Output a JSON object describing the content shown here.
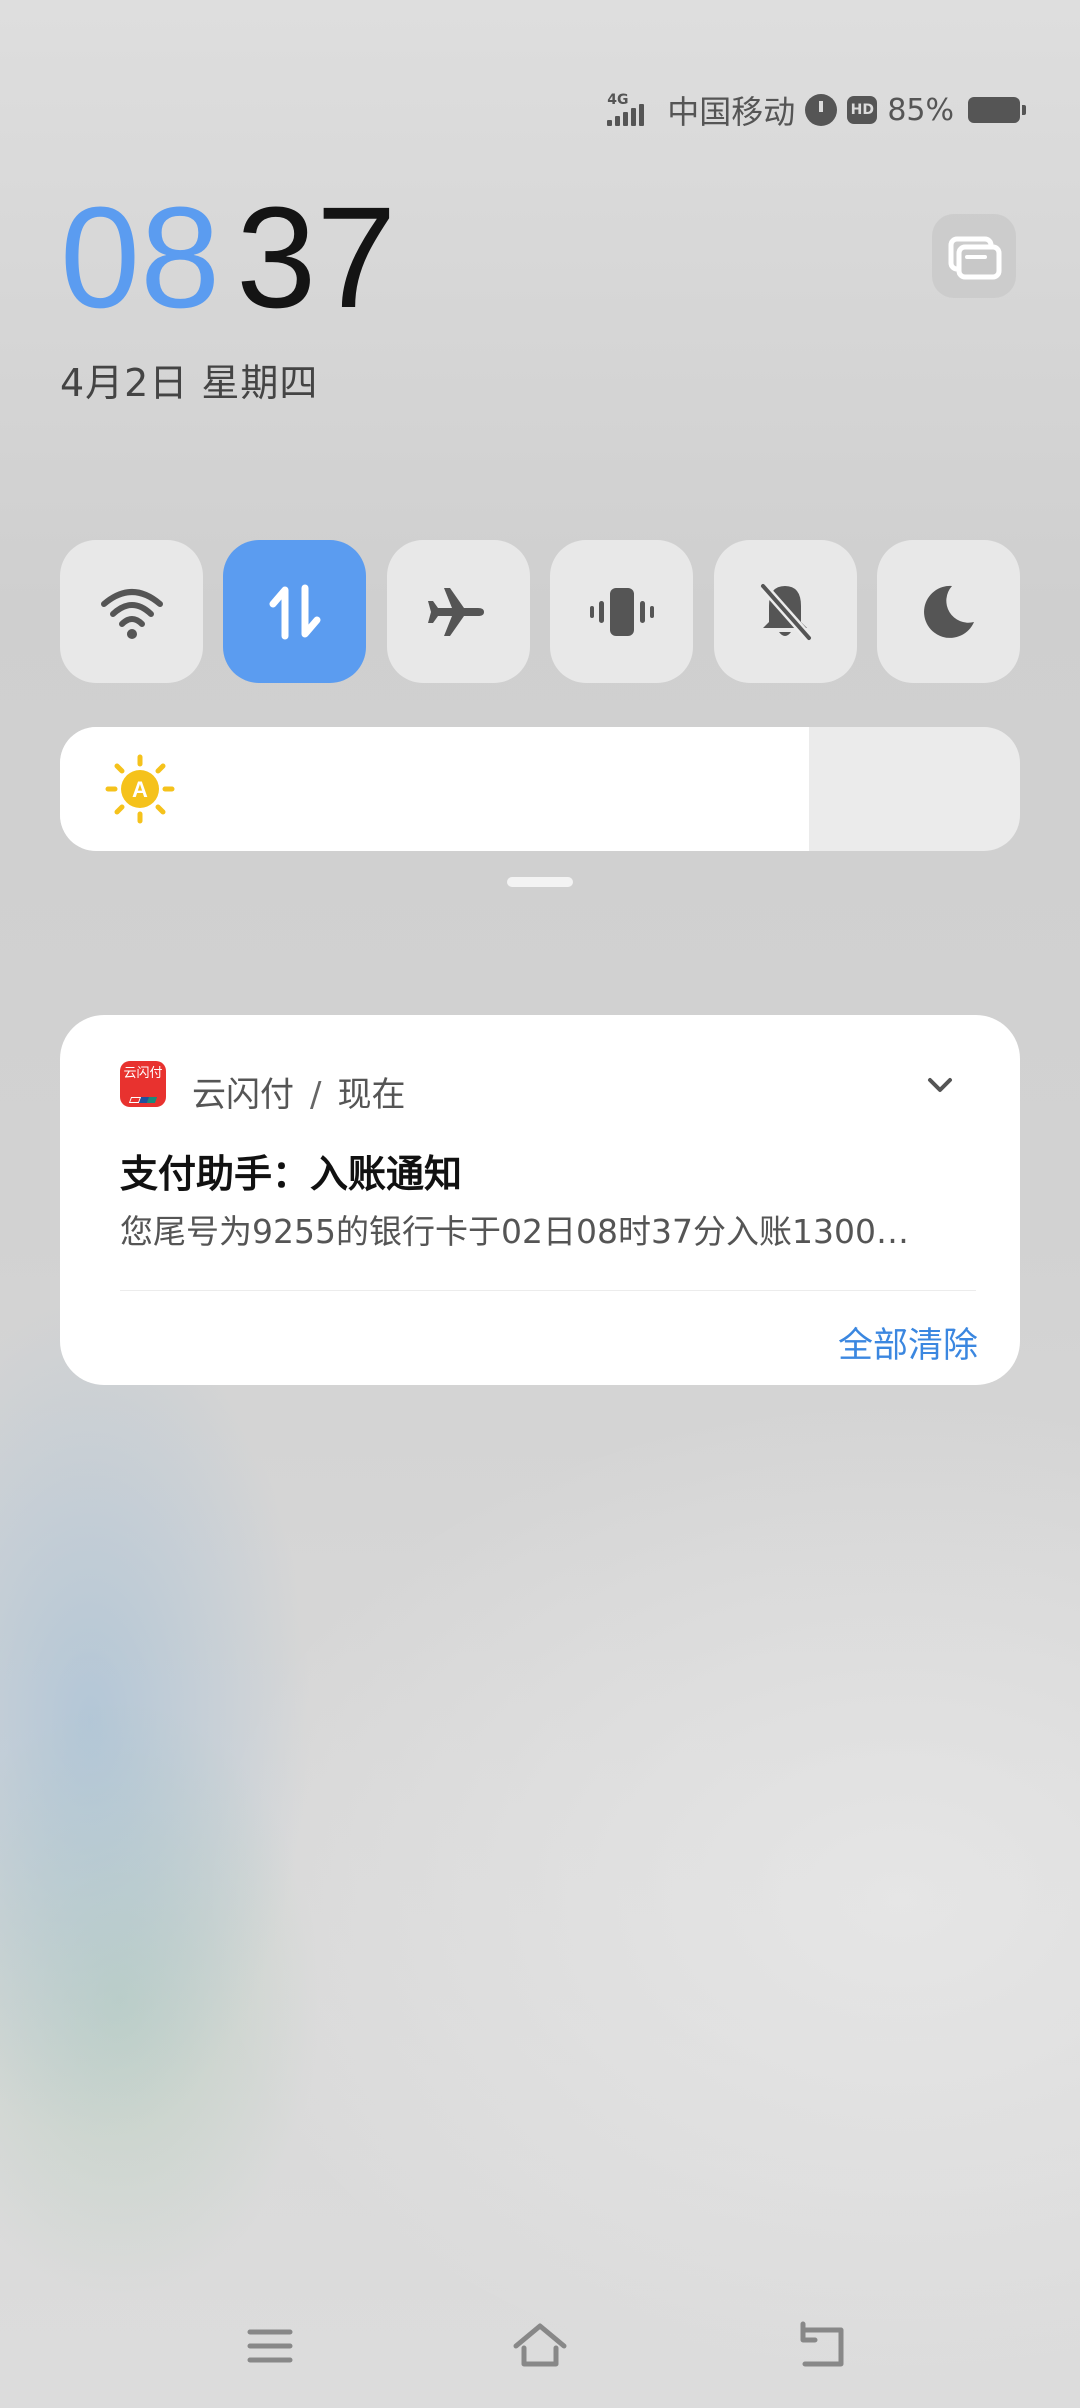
{
  "status_bar": {
    "network_type": "4G",
    "carrier": "中国移动",
    "hd_badge": "HD",
    "battery_text": "85%",
    "battery_level": 0.85,
    "icons": [
      "signal-icon",
      "alarm-icon",
      "hd-icon",
      "battery-icon"
    ]
  },
  "clock": {
    "hour": "08",
    "minute": "37",
    "date": "4月2日 星期四",
    "hour_color": "#5b9cf0"
  },
  "quick_settings": {
    "tiles": [
      {
        "name": "wifi",
        "icon": "wifi-icon",
        "active": false
      },
      {
        "name": "mobile-data",
        "icon": "data-transfer-icon",
        "active": true
      },
      {
        "name": "airplane-mode",
        "icon": "airplane-icon",
        "active": false
      },
      {
        "name": "vibrate",
        "icon": "vibrate-icon",
        "active": false
      },
      {
        "name": "mute",
        "icon": "bell-off-icon",
        "active": false
      },
      {
        "name": "do-not-disturb",
        "icon": "moon-icon",
        "active": false
      }
    ],
    "active_color": "#5b9cf0",
    "brightness_level": 0.78,
    "brightness_icon": "auto-brightness-sun-icon",
    "auto_brightness_label": "A"
  },
  "notification": {
    "app_name": "云闪付",
    "app_icon_label": "云闪付",
    "separator": "/",
    "time": "现在",
    "title": "支付助手：入账通知",
    "body": "您尾号为9255的银行卡于02日08时37分入账1300…",
    "clear_all": "全部清除",
    "accent_color": "#3b87e0"
  },
  "nav_bar": {
    "buttons": [
      "menu-icon",
      "home-icon",
      "back-icon"
    ]
  }
}
